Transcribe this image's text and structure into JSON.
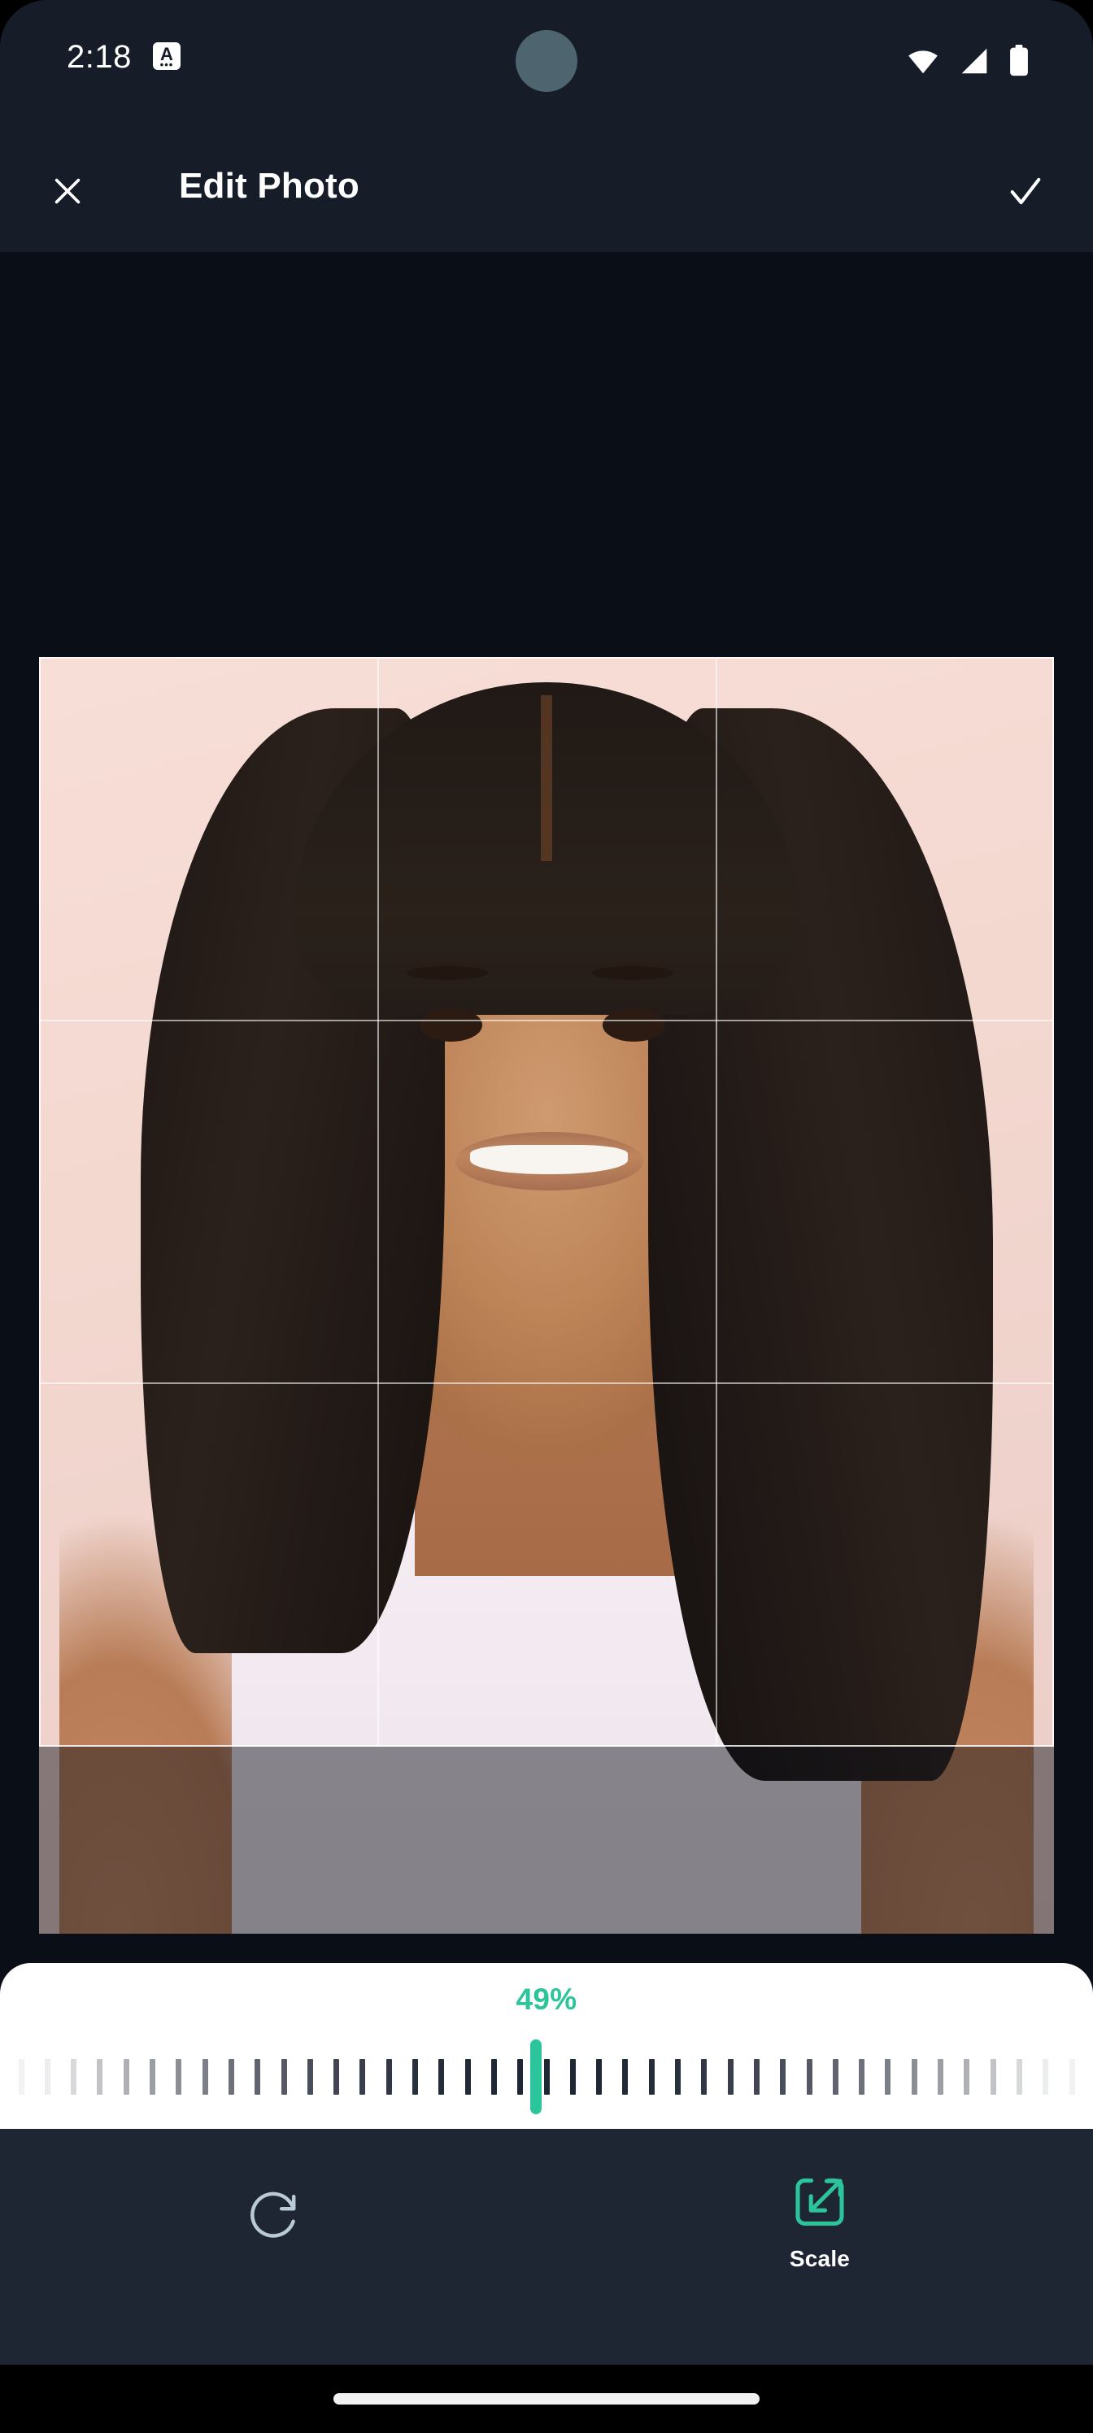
{
  "status_bar": {
    "time": "2:18",
    "badge_letter": "A",
    "badge_name": "alarm-or-app-badge",
    "icons": [
      "wifi-icon",
      "cellular-signal-icon",
      "battery-icon"
    ]
  },
  "app_bar": {
    "title": "Edit Photo",
    "close_icon": "close-icon",
    "done_icon": "check-icon"
  },
  "editor": {
    "subject": "Portrait photo of a smiling woman with long straight black hair wearing a white tank top on a pink background",
    "crop_overlay": {
      "grid": "rule-of-thirds",
      "frame_color": "#FFFFFF",
      "dim_color": "rgba(10,14,22,0.46)"
    }
  },
  "scale_slider": {
    "value_label": "49%",
    "value": 49,
    "min": 0,
    "max": 100,
    "accent_color": "#2CC49A",
    "tick_count": 41,
    "panel_color": "#FFFFFF"
  },
  "toolbar": {
    "items": [
      {
        "id": "rotate",
        "label": "",
        "icon": "rotate-icon",
        "active": false,
        "color": "#B9CAD6"
      },
      {
        "id": "scale",
        "label": "Scale",
        "icon": "scale-icon",
        "active": true,
        "color": "#2CC49A"
      }
    ]
  },
  "nav_bar": {
    "home_indicator": "home-indicator"
  },
  "theme": {
    "background": "#0A0E16",
    "surface": "#161C28",
    "toolbar": "#1E2533",
    "accent": "#2CC49A",
    "text_primary": "#FFFFFF"
  }
}
